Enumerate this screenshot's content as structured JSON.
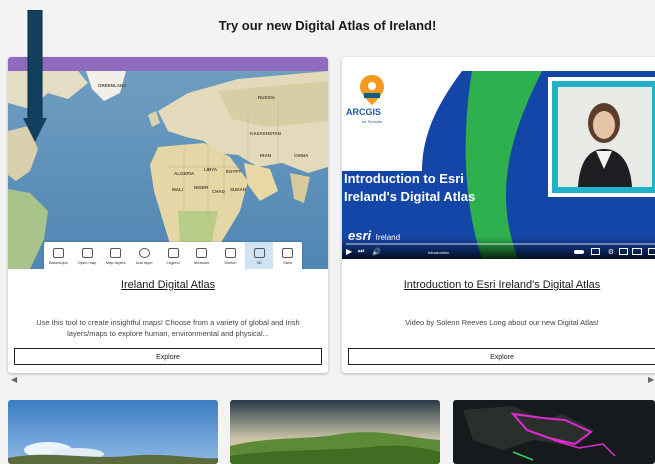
{
  "page": {
    "title": "Try our new Digital Atlas of Ireland!"
  },
  "cards": [
    {
      "title": "Ireland Digital Atlas",
      "description": "Use this tool to create insightful maps! Choose from a variety of global and Irish layers/maps to explore human, environmental and physical...",
      "button_label": "Explore",
      "toolbar": [
        {
          "label": "Basemaps",
          "icon": "basemap-icon"
        },
        {
          "label": "Open map",
          "icon": "open-map-icon"
        },
        {
          "label": "Map layers",
          "icon": "layers-icon"
        },
        {
          "label": "Add layer",
          "icon": "add-layer-icon"
        },
        {
          "label": "Legend",
          "icon": "legend-icon"
        },
        {
          "label": "Measure",
          "icon": "measure-icon"
        },
        {
          "label": "Sketch",
          "icon": "sketch-icon"
        },
        {
          "label": "3D",
          "icon": "3d-icon"
        },
        {
          "label": "Save",
          "icon": "save-icon"
        }
      ],
      "map_labels": [
        "GREENLAND",
        "RUSSIA",
        "KAZAKHSTAN",
        "CHINA",
        "ALGERIA",
        "LIBYA",
        "EGYPT",
        "MALI",
        "NIGER",
        "CHAD",
        "SUDAN",
        "IRAN"
      ]
    },
    {
      "title": "Introduction to Esri Ireland's Digital Atlas",
      "description": "Video by Solenn Reeves Long about our new Digital Atlas!",
      "button_label": "Explore",
      "video": {
        "logo_text": "ARCGIS",
        "logo_sub": "for Schools",
        "headline_line1": "Introduction to Esri",
        "headline_line2": "Ireland's Digital Atlas",
        "brand": "esri",
        "brand_sub": "Ireland",
        "chapter": "Introduction"
      }
    }
  ],
  "colors": {
    "accent": "#8e6bbd",
    "arrow": "#12405e"
  }
}
